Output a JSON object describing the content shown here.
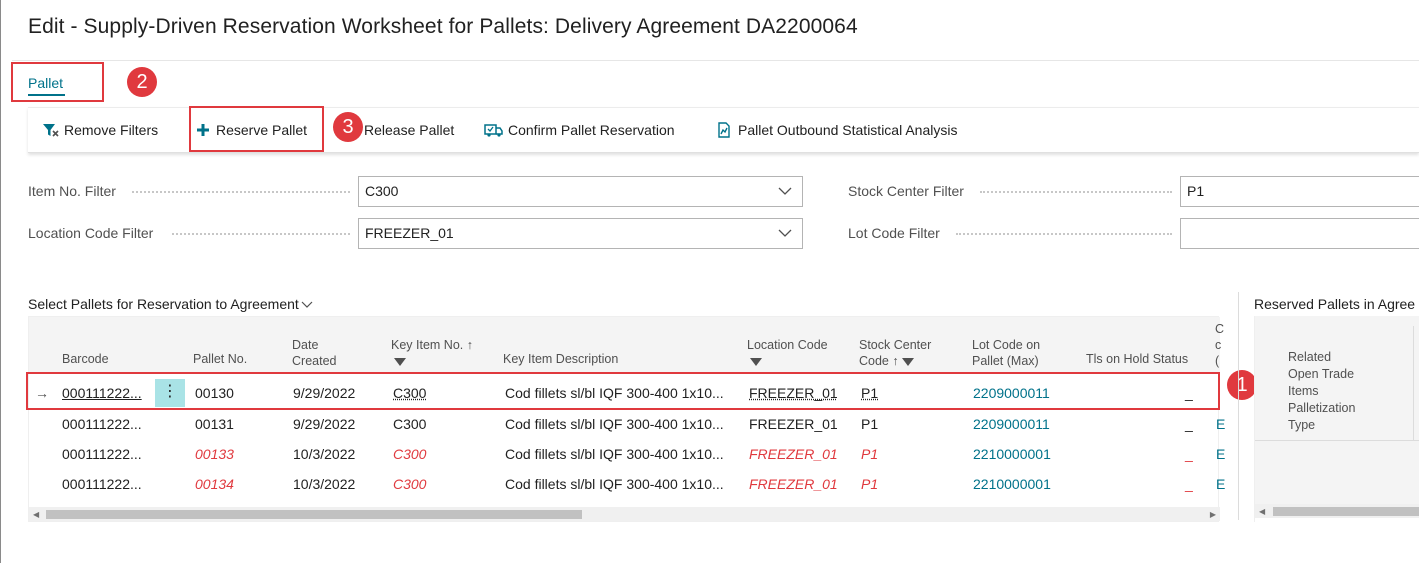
{
  "page": {
    "title": "Edit - Supply-Driven Reservation Worksheet for Pallets: Delivery Agreement DA2200064"
  },
  "tabs": {
    "pallet": "Pallet"
  },
  "toolbar": {
    "remove_filters": "Remove Filters",
    "reserve_pallet": "Reserve Pallet",
    "release_pallet": "Release Pallet",
    "confirm_reservation": "Confirm Pallet Reservation",
    "outbound_analysis": "Pallet Outbound Statistical Analysis"
  },
  "badges": {
    "one": "1",
    "two": "2",
    "three": "3"
  },
  "filters": {
    "item_no": {
      "label": "Item No. Filter",
      "value": "C300"
    },
    "location_code": {
      "label": "Location Code Filter",
      "value": "FREEZER_01"
    },
    "stock_center": {
      "label": "Stock Center Filter",
      "value": "P1"
    },
    "lot_code": {
      "label": "Lot Code Filter",
      "value": ""
    }
  },
  "main_list": {
    "title": "Select Pallets for Reservation to Agreement",
    "columns": {
      "barcode": "Barcode",
      "pallet_no": "Pallet No.",
      "date_created_1": "Date",
      "date_created_2": "Created",
      "key_item_no": "Key Item No.",
      "key_item_description": "Key Item Description",
      "location_code": "Location Code",
      "stock_center_1": "Stock Center",
      "stock_center_2": "Code",
      "lot_code_1": "Lot Code on",
      "lot_code_2": "Pallet (Max)",
      "tls_on_hold": "Tls on Hold Status",
      "next_col_1": "C",
      "next_col_2": "c",
      "next_col_3": "("
    },
    "rows": [
      {
        "barcode": "000111222...",
        "pallet_no": "00130",
        "date": "9/29/2022",
        "item": "C300",
        "desc": "Cod fillets sl/bl IQF 300-400 1x10...",
        "location": "FREEZER_01",
        "stock_center": "P1",
        "lot": "2209000011",
        "hold": "_",
        "extra": "",
        "highlight": false
      },
      {
        "barcode": "000111222...",
        "pallet_no": "00131",
        "date": "9/29/2022",
        "item": "C300",
        "desc": "Cod fillets sl/bl IQF 300-400 1x10...",
        "location": "FREEZER_01",
        "stock_center": "P1",
        "lot": "2209000011",
        "hold": "_",
        "extra": "E",
        "highlight": false
      },
      {
        "barcode": "000111222...",
        "pallet_no": "00133",
        "date": "10/3/2022",
        "item": "C300",
        "desc": "Cod fillets sl/bl IQF 300-400 1x10...",
        "location": "FREEZER_01",
        "stock_center": "P1",
        "lot": "2210000001",
        "hold": "_",
        "extra": "E",
        "highlight": true
      },
      {
        "barcode": "000111222...",
        "pallet_no": "00134",
        "date": "10/3/2022",
        "item": "C300",
        "desc": "Cod fillets sl/bl IQF 300-400 1x10...",
        "location": "FREEZER_01",
        "stock_center": "P1",
        "lot": "2210000001",
        "hold": "_",
        "extra": "E",
        "highlight": true
      }
    ]
  },
  "reserved_list": {
    "title": "Reserved Pallets in Agree",
    "columns": {
      "l1": "Related",
      "l2": "Open Trade",
      "l3": "Items",
      "l4": "Palletization",
      "l5": "Type"
    }
  },
  "colors": {
    "accent": "#00728a",
    "annotation": "#e0393e",
    "attention": "#e0393e"
  },
  "icons": {
    "remove_filters": "filter-remove-icon",
    "reserve_pallet": "plus-icon",
    "confirm_reservation": "truck-check-icon",
    "outbound_analysis": "chart-document-icon"
  }
}
